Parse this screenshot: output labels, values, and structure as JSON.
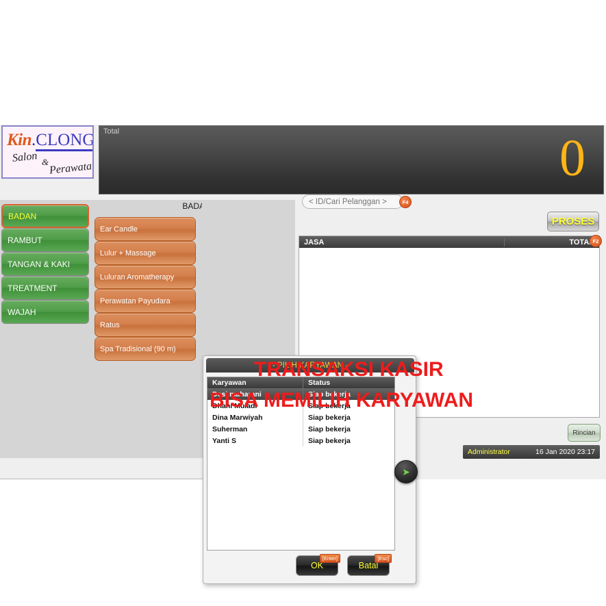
{
  "app": {
    "logo": {
      "part1": "Kin",
      "dot": ".",
      "part2": "CLONG",
      "salon": "Salon",
      "amp": "&",
      "perawatan": "Perawatan"
    },
    "total_panel": {
      "label": "Total",
      "value": "0"
    }
  },
  "categories": [
    {
      "label": "BADAN",
      "active": true
    },
    {
      "label": "RAMBUT",
      "active": false
    },
    {
      "label": "TANGAN & KAKI",
      "active": false
    },
    {
      "label": "TREATMENT",
      "active": false
    },
    {
      "label": "WAJAH",
      "active": false
    }
  ],
  "services": {
    "header": "BADAN",
    "items": [
      {
        "label": "Ear Candle"
      },
      {
        "label": "Lulur + Massage"
      },
      {
        "label": "Luluran Aromatherapy"
      },
      {
        "label": "Perawatan Payudara"
      },
      {
        "label": "Ratus"
      },
      {
        "label": "Spa Tradisional (90 m)"
      }
    ]
  },
  "right": {
    "search_placeholder": "< ID/Cari Pelanggan >",
    "search_value": "",
    "search_key": "F4",
    "proses_label": "PROSES",
    "jasa_header": "JASA",
    "total_header": "TOTAL",
    "total_key": "F2",
    "rincian_label": "Rincian",
    "status_user": "Administrator",
    "status_datetime": "16 Jan 2020  23:17"
  },
  "dialog": {
    "title": "- PILIH KARYAWAN -",
    "columns": [
      "Karyawan",
      "Status"
    ],
    "rows": [
      {
        "karyawan": "Desi maharani",
        "status": "Siap bekerja",
        "selected": true
      },
      {
        "karyawan": "Dhani Muladi",
        "status": "Siap bekerja",
        "selected": false
      },
      {
        "karyawan": "Dina Marwiyah",
        "status": "Siap bekerja",
        "selected": false
      },
      {
        "karyawan": "Suherman",
        "status": "Siap bekerja",
        "selected": false
      },
      {
        "karyawan": "Yanti S",
        "status": "Siap bekerja",
        "selected": false
      }
    ],
    "arrow_icon": "arrow-right-icon",
    "ok_label": "OK",
    "ok_key": "[Enter]",
    "cancel_label": "Batal",
    "cancel_key": "[Esc]"
  },
  "annotation": {
    "line1": "TRANSAKSI KASIR",
    "line2": "BISA MEMILIH KARYAWAN",
    "color": "#ee1c1c"
  }
}
